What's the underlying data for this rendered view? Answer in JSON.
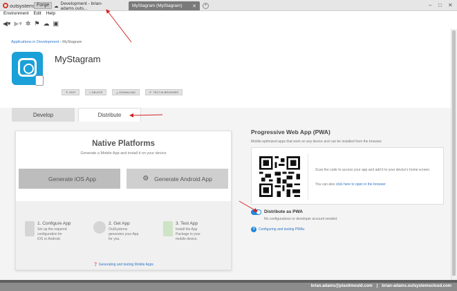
{
  "titlebar": {
    "brand": "outsystems",
    "forge": "Forge",
    "tabs": [
      {
        "label": "Development - brian-adams.outs..."
      },
      {
        "label": "MyStagram (MyStagram)"
      }
    ],
    "new_tab": "+",
    "window_controls": [
      "–",
      "□",
      "✕"
    ]
  },
  "menu": [
    "Environment",
    "Edit",
    "Help"
  ],
  "toolbar_icons": [
    "back-icon",
    "forward-icon",
    "gear-icon",
    "publish-icon",
    "deploy-icon",
    "gift-icon"
  ],
  "breadcrumb": {
    "parent": "Applications in Development",
    "sep": " › ",
    "current": "MyStagram"
  },
  "app": {
    "title": "MyStagram",
    "icon_color": "#1ba0d8"
  },
  "actions": [
    {
      "label": "EDIT",
      "icon": "pencil-icon"
    },
    {
      "label": "DELETE",
      "icon": "trash-icon"
    },
    {
      "label": "DOWNLOAD",
      "icon": "download-icon"
    },
    {
      "label": "TEST IN BROWSER",
      "icon": "wrench-icon"
    }
  ],
  "tabs": {
    "develop": "Develop",
    "distribute": "Distribute",
    "active": "distribute"
  },
  "native": {
    "title": "Native Platforms",
    "subtitle": "Generate a Mobile App and install it on your device",
    "ios_button": "Generate iOS App",
    "android_button": "Generate Android App",
    "steps": [
      {
        "title": "1. Configure App",
        "desc": [
          "Set up the required",
          "configuration for",
          "iOS or Android."
        ]
      },
      {
        "title": "2. Get App",
        "desc": [
          "OutSystems",
          "generates your App",
          "for you."
        ]
      },
      {
        "title": "3. Test App",
        "desc": [
          "Install the App",
          "Package in your",
          "mobile device."
        ]
      }
    ],
    "help_link": "Generating and testing Mobile Apps"
  },
  "pwa": {
    "title": "Progressive Web App (PWA)",
    "subtitle": "Mobile-optimized apps that work on any device and can be installed from the browser.",
    "scan_text": "Scan the code to access your app and add it to your device's home screen.",
    "link_prefix": "You can also ",
    "link_text": "click here to open in the browser",
    "toggle_label": "Distribute as PWA",
    "toggle_on": true,
    "toggle_sub": "No configurations or developer account needed.",
    "help_link": "Configuring and testing PWAs"
  },
  "status": {
    "user": "brian.adams@plastimould.com",
    "sep": "|",
    "server": "brian-adams.outsystemscloud.com"
  },
  "colors": {
    "accent": "#1f87d8",
    "link": "#2f75c7",
    "annotation": "#d42020"
  }
}
